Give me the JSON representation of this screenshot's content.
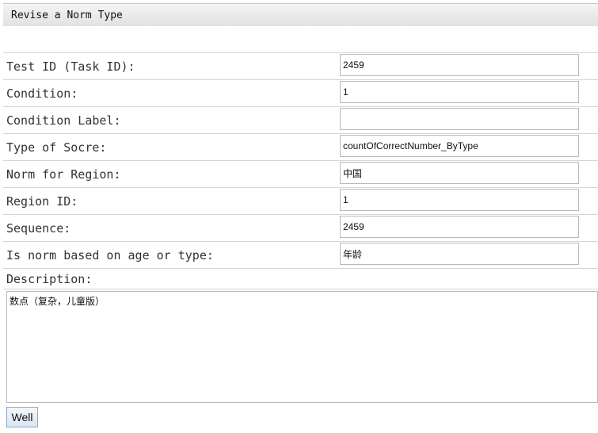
{
  "panel": {
    "title": "Revise a Norm Type"
  },
  "form": {
    "fields": [
      {
        "label": "Test ID (Task ID):",
        "value": "2459"
      },
      {
        "label": "Condition:",
        "value": "1"
      },
      {
        "label": "Condition Label:",
        "value": ""
      },
      {
        "label": "Type of Socre:",
        "value": "countOfCorrectNumber_ByType"
      },
      {
        "label": "Norm for Region:",
        "value": "中国"
      },
      {
        "label": "Region ID:",
        "value": "1"
      },
      {
        "label": "Sequence:",
        "value": "2459"
      },
      {
        "label": "Is norm based on age or type:",
        "value": "年龄"
      }
    ],
    "description": {
      "label": "Description:",
      "value": "数点（复杂，儿童版）"
    },
    "submit_label": "Well"
  }
}
